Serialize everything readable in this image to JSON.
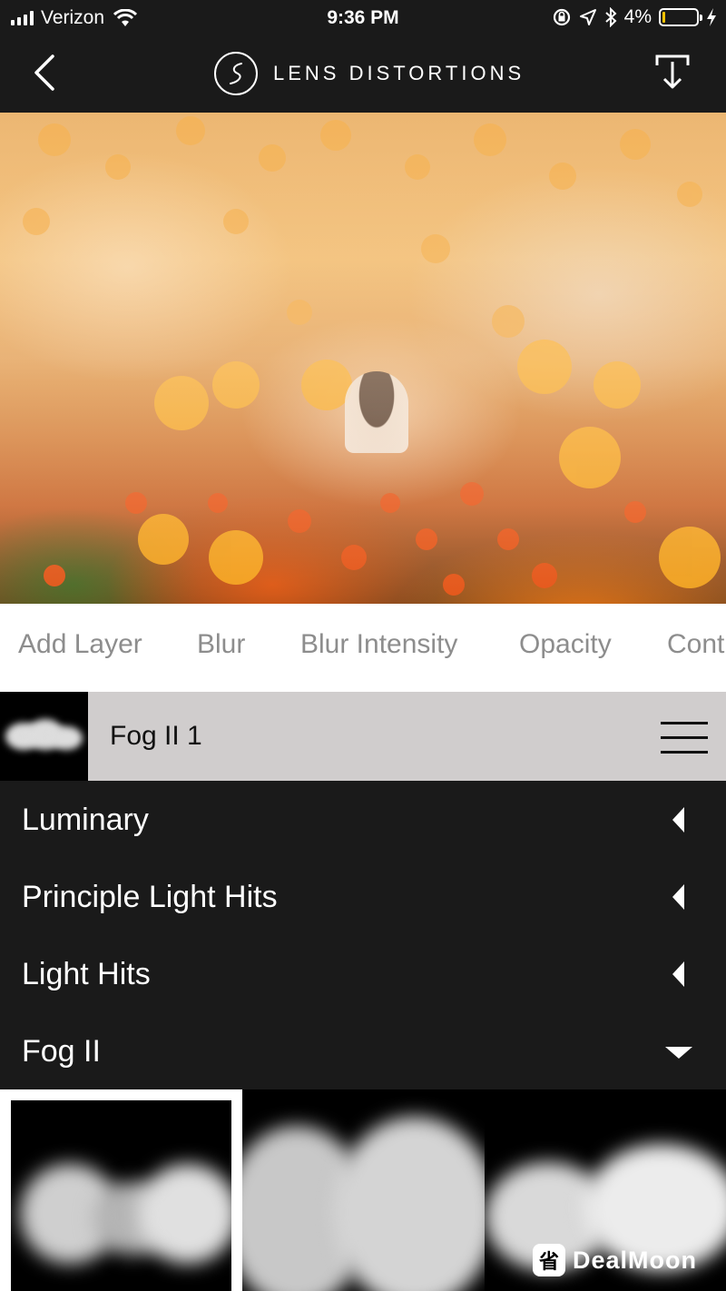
{
  "status_bar": {
    "carrier": "Verizon",
    "time": "9:36 PM",
    "battery_percent": "4%",
    "battery_level": 0.04,
    "icons": [
      "signal-icon",
      "wifi-icon",
      "orientation-lock-icon",
      "location-icon",
      "bluetooth-icon",
      "battery-icon",
      "charging-icon"
    ]
  },
  "header": {
    "title": "LENS DISTORTIONS",
    "icons": [
      "back-chevron-icon",
      "lens-distortions-logo",
      "download-icon"
    ]
  },
  "tabs": [
    "Add Layer",
    "Blur",
    "Blur Intensity",
    "Opacity",
    "Cont"
  ],
  "layer": {
    "name": "Fog II 1",
    "icons": [
      "hamburger-menu-icon"
    ]
  },
  "categories": [
    {
      "label": "Luminary",
      "expanded": false
    },
    {
      "label": "Principle Light Hits",
      "expanded": false
    },
    {
      "label": "Light Hits",
      "expanded": false
    },
    {
      "label": "Fog II",
      "expanded": true
    }
  ],
  "fog_presets": {
    "count_visible": 3,
    "selected_index": 0
  },
  "watermark": {
    "text": "DealMoon"
  },
  "colors": {
    "background": "#1a1a1a",
    "tab_strip": "#ffffff",
    "tab_text": "#8d8d8d",
    "layer_row": "#d0cdcd",
    "battery_low": "#f2c200"
  }
}
